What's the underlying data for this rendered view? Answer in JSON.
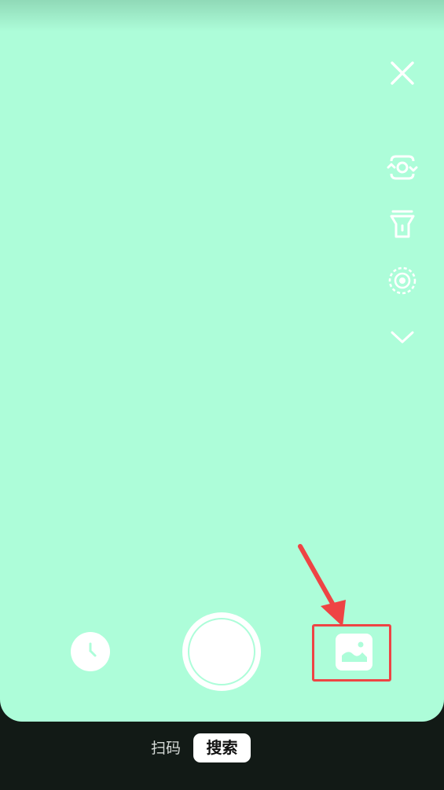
{
  "camera": {
    "close_icon": "close-icon",
    "side_tools": [
      {
        "name": "switch-camera-icon"
      },
      {
        "name": "flashlight-icon"
      },
      {
        "name": "focus-mode-icon"
      },
      {
        "name": "collapse-chevron-icon"
      }
    ],
    "history_icon": "clock-icon",
    "shutter": "shutter-button",
    "gallery_icon": "image-gallery-icon"
  },
  "modes": {
    "scan_label": "扫码",
    "search_label": "搜索",
    "active": "search"
  },
  "colors": {
    "viewfinder": "#adfdd9",
    "background": "#121a16",
    "annotation": "#ee4444"
  }
}
